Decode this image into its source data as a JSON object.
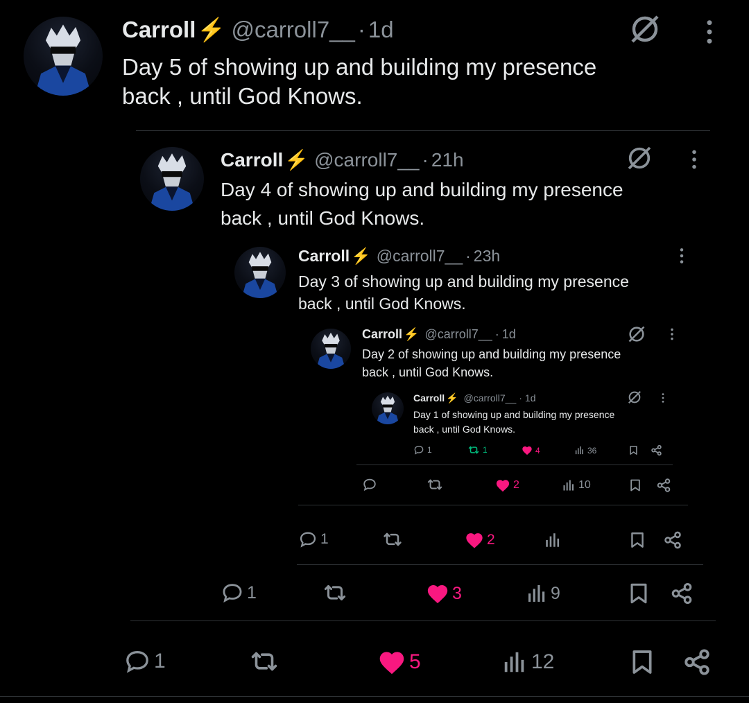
{
  "posts": [
    {
      "name": "Carroll",
      "bolt": "⚡",
      "handle": "@carroll7__",
      "sep": "·",
      "time": "1d",
      "text_line1": "Day 5 of showing up and building my presence",
      "text_line2": "back , until God Knows.",
      "actions": {
        "reply": "1",
        "repost": "",
        "like": "5",
        "views": "12"
      }
    },
    {
      "name": "Carroll",
      "bolt": "⚡",
      "handle": "@carroll7__",
      "sep": "·",
      "time": "21h",
      "text_line1": "Day 4 of showing up and building my presence",
      "text_line2": "back , until God Knows.",
      "actions": {
        "reply": "1",
        "repost": "",
        "like": "3",
        "views": "9"
      }
    },
    {
      "name": "Carroll",
      "bolt": "⚡",
      "handle": "@carroll7__",
      "sep": "·",
      "time": "23h",
      "text_line1": "Day 3 of showing up and building my presence",
      "text_line2": "back , until God Knows.",
      "actions": {
        "reply": "1",
        "repost": "",
        "like": "2",
        "views": ""
      }
    },
    {
      "name": "Carroll",
      "bolt": "⚡",
      "handle": "@carroll7__",
      "sep": "·",
      "time": "1d",
      "text_line1": "Day 2 of showing up and building my presence",
      "text_line2": "back , until God Knows.",
      "actions": {
        "reply": "",
        "repost": "",
        "like": "2",
        "views": "10"
      }
    },
    {
      "name": "Carroll",
      "bolt": "⚡",
      "handle": "@carroll7__",
      "sep": "·",
      "time": "1d",
      "text_line1": "Day 1 of showing up and building my presence",
      "text_line2": "back , until God Knows.",
      "actions": {
        "reply": "1",
        "repost": "1",
        "like": "4",
        "views": "36"
      }
    }
  ],
  "icons": {
    "no_entry": "no-entry-icon",
    "more": "more-options-icon",
    "reply": "reply-icon",
    "repost": "repost-icon",
    "like": "heart-icon",
    "views": "views-icon",
    "bookmark": "bookmark-icon",
    "share": "share-icon"
  },
  "colors": {
    "like": "#f91880",
    "repost_active": "#00ba7c",
    "bolt": "#f6c10d",
    "muted": "#8b9299"
  }
}
